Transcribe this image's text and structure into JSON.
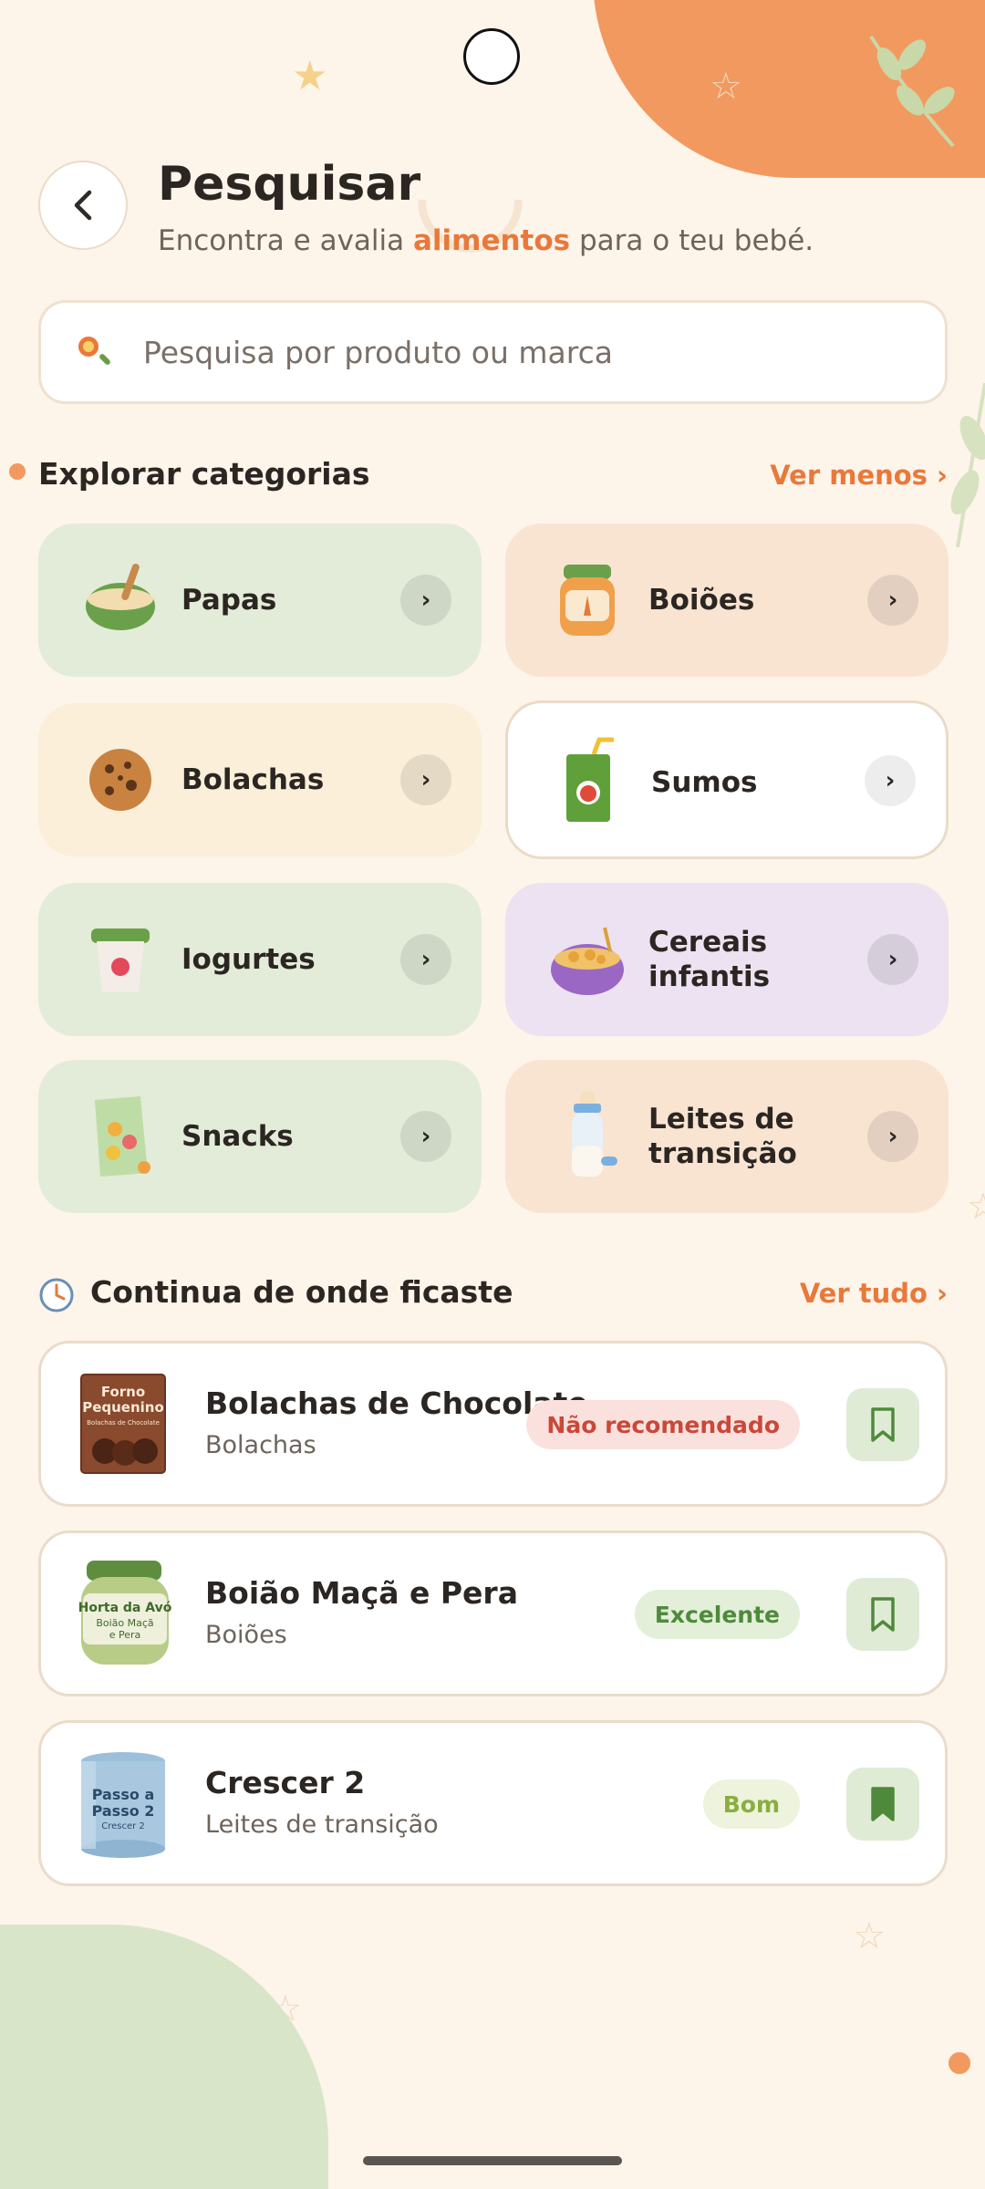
{
  "header": {
    "back_icon": "chevron-left-icon",
    "title": "Pesquisar",
    "subtitle_before": "Encontra e avalia ",
    "subtitle_highlight": "alimentos",
    "subtitle_after": " para o teu bebé."
  },
  "search": {
    "icon": "search-icon",
    "placeholder": "Pesquisa por produto ou marca"
  },
  "categories_section": {
    "title": "Explorar categorias",
    "link": "Ver menos ›",
    "items": [
      {
        "label": "Papas",
        "icon": "porridge-bowl-icon",
        "chevron": "›"
      },
      {
        "label": "Boiões",
        "icon": "baby-food-jar-icon",
        "chevron": "›"
      },
      {
        "label": "Bolachas",
        "icon": "cookie-icon",
        "chevron": "›"
      },
      {
        "label": "Sumos",
        "icon": "juice-box-icon",
        "chevron": "›"
      },
      {
        "label": "Iogurtes",
        "icon": "yogurt-cup-icon",
        "chevron": "›"
      },
      {
        "label": "Cereais infantis",
        "icon": "cereal-bowl-icon",
        "chevron": "›"
      },
      {
        "label": "Snacks",
        "icon": "snack-bag-icon",
        "chevron": "›"
      },
      {
        "label": "Leites de transição",
        "icon": "baby-bottle-icon",
        "chevron": "›"
      }
    ]
  },
  "recent_section": {
    "icon": "clock-icon",
    "title": "Continua de onde ficaste",
    "link": "Ver tudo ›",
    "items": [
      {
        "name": "Bolachas de Chocolate",
        "category": "Bolachas",
        "badge": "Não recomendado",
        "badge_color": "#c9483a",
        "badge_bg": "#fbe1dd",
        "thumb_text": [
          "Forno",
          "Pequenino",
          "Bolachas de Chocolate"
        ],
        "bookmarked": false
      },
      {
        "name": "Boião Maçã e Pera",
        "category": "Boiões",
        "badge": "Excelente",
        "badge_color": "#4f8a3c",
        "badge_bg": "#e3efd8",
        "thumb_text": [
          "Horta da Avó",
          "Boião Maçã",
          "e Pera"
        ],
        "bookmarked": false
      },
      {
        "name": "Crescer 2",
        "category": "Leites de transição",
        "badge": "Bom",
        "badge_color": "#8aae3e",
        "badge_bg": "#edf3dc",
        "thumb_text": [
          "Passo a",
          "Passo 2",
          "Crescer 2"
        ],
        "bookmarked": true
      }
    ]
  },
  "colors": {
    "accent": "#e8793a",
    "background": "#fdf4ea",
    "bookmark_green": "#4f8a3c"
  }
}
